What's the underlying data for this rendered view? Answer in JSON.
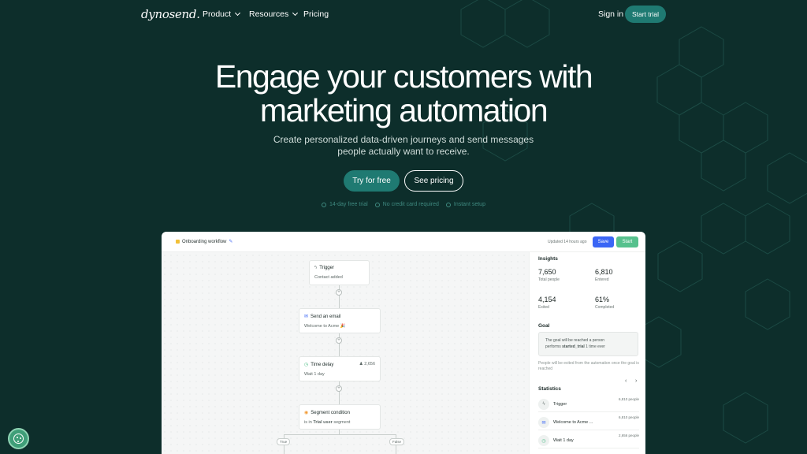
{
  "nav": {
    "logo": "dynosend.",
    "items": [
      {
        "label": "Product",
        "has_dropdown": true
      },
      {
        "label": "Resources",
        "has_dropdown": true
      },
      {
        "label": "Pricing",
        "has_dropdown": false
      }
    ],
    "signin": "Sign in",
    "start_trial": "Start trial"
  },
  "hero": {
    "title_line1": "Engage your customers with",
    "title_line2": "marketing automation",
    "subtitle_line1": "Create personalized data-driven journeys and send messages",
    "subtitle_line2": "people actually want to receive.",
    "primary_cta": "Try for free",
    "secondary_cta": "See pricing",
    "perks": [
      "14-day free trial",
      "No credit card required",
      "Instant setup"
    ]
  },
  "app": {
    "workflow_title": "Onboarding workflow",
    "updated": "Updated 14 hours ago",
    "save": "Save",
    "start": "Start",
    "nodes": {
      "trigger": {
        "title": "Trigger",
        "sub": "Contact added"
      },
      "email": {
        "title": "Send an email",
        "sub": "Welcome to Acme 🎉"
      },
      "delay": {
        "title": "Time delay",
        "sub": "Wait 1 day",
        "count": "2,656"
      },
      "segment": {
        "title": "Segment condition",
        "sub_prefix": "is in",
        "sub_bold": "Trial user",
        "sub_suffix": "segment"
      }
    },
    "branches": {
      "true": "True",
      "false": "False"
    },
    "insights": {
      "heading": "Insights",
      "stats": [
        {
          "value": "7,650",
          "label": "Total people"
        },
        {
          "value": "6,810",
          "label": "Entered"
        },
        {
          "value": "4,154",
          "label": "Exited"
        },
        {
          "value": "61%",
          "label": "Completed"
        }
      ],
      "goal_heading": "Goal",
      "goal_text_1": "The goal will be reached a person",
      "goal_text_2_prefix": "performs",
      "goal_text_2_bold": "started_trial",
      "goal_text_2_suffix": "1  time ever",
      "goal_note": "People will be exited from the automation once the goal is reached",
      "statistics_heading": "Statistics",
      "rows": [
        {
          "label": "Trigger",
          "count": "6,810 people"
        },
        {
          "label": "Welcome to Acme ...",
          "count": "6,810 people"
        },
        {
          "label": "Wait 1 day",
          "count": "2,656 people"
        }
      ]
    }
  },
  "colors": {
    "background": "#0d2e2b",
    "accent": "#1f7a72",
    "save_blue": "#3b66f5",
    "start_green": "#56c18d"
  },
  "icons": {
    "cookie": "cookie-icon"
  }
}
